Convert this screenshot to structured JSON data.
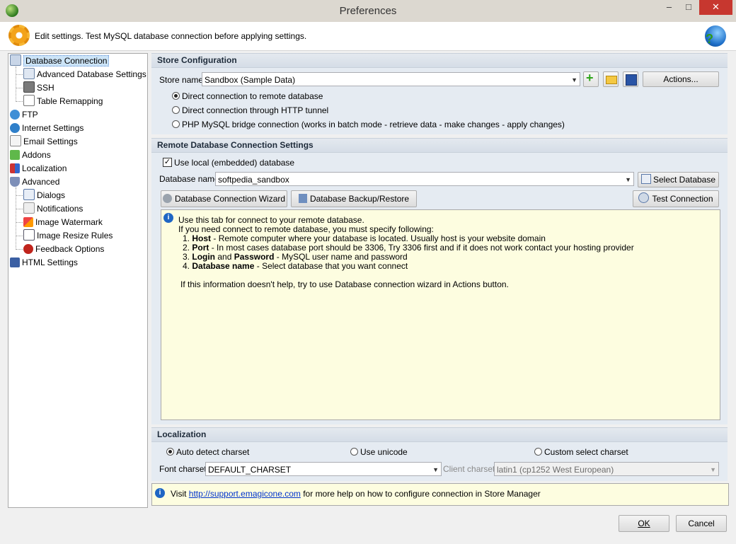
{
  "window": {
    "title": "Preferences",
    "minimize": "–",
    "maximize": "□",
    "close": "✕"
  },
  "header": {
    "text": "Edit settings. Test MySQL database connection before applying settings."
  },
  "tree": [
    {
      "label": "Database Connection",
      "icon": "database-icon",
      "selected": true
    },
    {
      "label": "Advanced Database Settings",
      "icon": "database-settings-icon"
    },
    {
      "label": "SSH",
      "icon": "ssh-icon"
    },
    {
      "label": "Table Remapping",
      "icon": "table-icon"
    },
    {
      "label": "FTP",
      "icon": "ftp-icon"
    },
    {
      "label": "Internet Settings",
      "icon": "globe-icon"
    },
    {
      "label": "Email Settings",
      "icon": "envelope-icon"
    },
    {
      "label": "Addons",
      "icon": "puzzle-icon"
    },
    {
      "label": "Localization",
      "icon": "flag-icon"
    },
    {
      "label": "Advanced",
      "icon": "shield-icon"
    },
    {
      "label": "Dialogs",
      "icon": "dialog-icon"
    },
    {
      "label": "Notifications",
      "icon": "notification-icon"
    },
    {
      "label": "Image Watermark",
      "icon": "watermark-icon"
    },
    {
      "label": "Image Resize Rules",
      "icon": "resize-icon"
    },
    {
      "label": "Feedback Options",
      "icon": "bug-icon"
    },
    {
      "label": "HTML Settings",
      "icon": "html-icon"
    }
  ],
  "store": {
    "header": "Store Configuration",
    "name_label": "Store name",
    "name_value": "Sandbox (Sample Data)",
    "actions": "Actions...",
    "options": [
      "Direct connection to remote database",
      "Direct connection through HTTP tunnel",
      "PHP MySQL bridge connection (works in batch mode - retrieve data - make changes - apply changes)"
    ],
    "selected_option": 0
  },
  "remote": {
    "header": "Remote Database Connection Settings",
    "use_local": "Use local (embedded) database",
    "use_local_checked": true,
    "dbname_label": "Database name",
    "dbname_value": "softpedia_sandbox",
    "select_db": "Select Database",
    "wizard": "Database Connection Wizard",
    "backup": "Database Backup/Restore",
    "test": "Test Connection"
  },
  "info": {
    "intro": "Use this tab for connect to your remote database.",
    "line2": "If you need connect to remote database, you must specify following:",
    "items": [
      {
        "num": "1.",
        "bold": "Host",
        "text": " - Remote computer where your database is located. Usually host is your website domain"
      },
      {
        "num": "2.",
        "bold": "Port",
        "text": " - In most cases database port should be 3306, Try 3306 first and if it does not work contact your hosting provider"
      },
      {
        "num": "3.",
        "bold": "Login",
        "mid": " and ",
        "bold2": "Password",
        "text": " - MySQL user name and password"
      },
      {
        "num": "4.",
        "bold": "Database name",
        "text": " - Select database that you want connect"
      }
    ],
    "footer": "If this information doesn't help, try to use Database connection wizard in Actions button."
  },
  "localization": {
    "header": "Localization",
    "auto": "Auto detect charset",
    "unicode": "Use unicode",
    "custom": "Custom select charset",
    "font_label": "Font charset",
    "font_value": "DEFAULT_CHARSET",
    "client_label": "Client charset",
    "client_value": "latin1 (cp1252 West European)"
  },
  "help": {
    "prefix": "Visit ",
    "link": "http://support.emagicone.com",
    "suffix": " for more help on how to configure connection in Store Manager"
  },
  "buttons": {
    "ok": "OK",
    "cancel": "Cancel"
  }
}
